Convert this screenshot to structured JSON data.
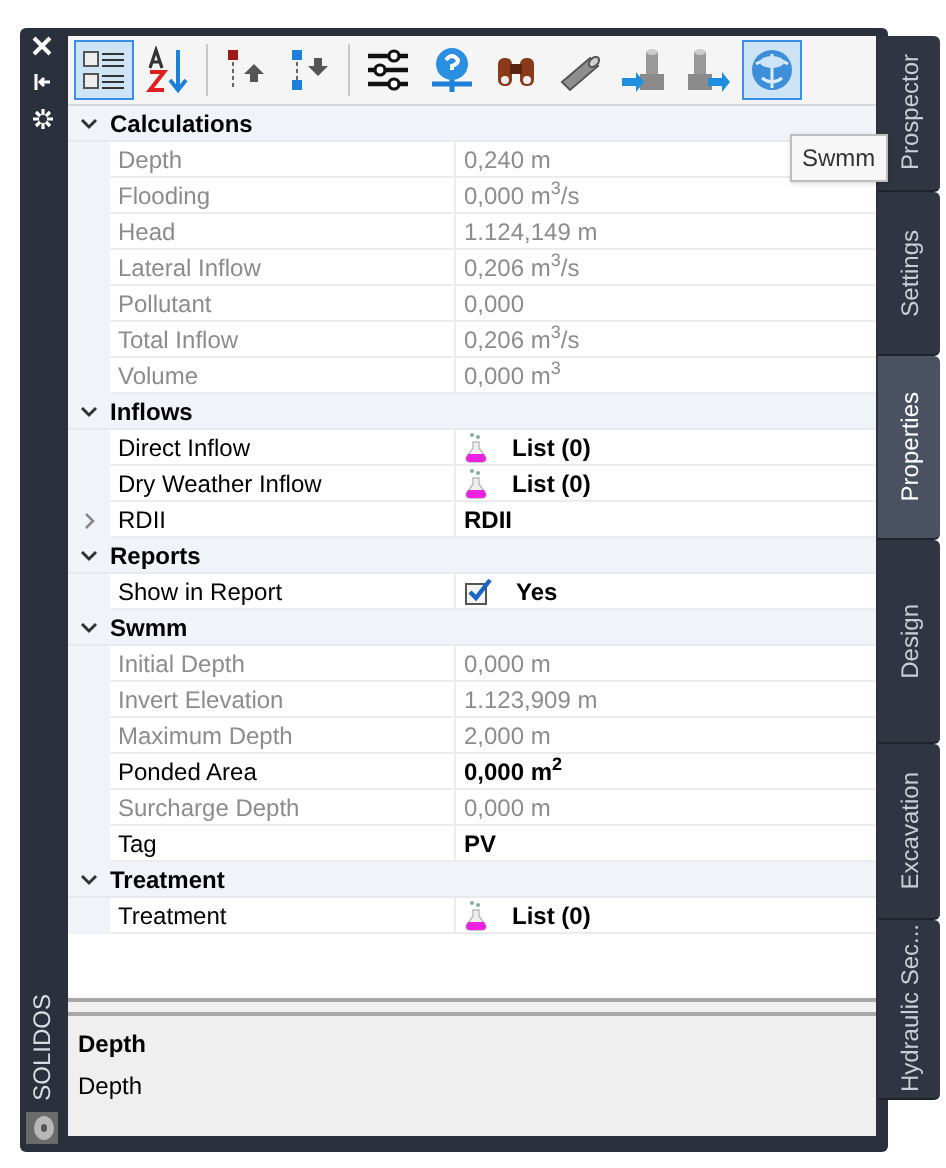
{
  "left_strip": {
    "title": "SOLIDOS"
  },
  "toolbar": [
    [
      {
        "kind": "categorized",
        "selected": true
      },
      {
        "kind": "alphabetical",
        "selected": false
      }
    ],
    [
      {
        "kind": "move-up",
        "selected": false
      },
      {
        "kind": "move-down",
        "selected": false
      }
    ],
    [
      {
        "kind": "filter",
        "selected": false
      },
      {
        "kind": "help",
        "selected": false
      },
      {
        "kind": "binoculars",
        "selected": false
      },
      {
        "kind": "pipe",
        "selected": false
      },
      {
        "kind": "inlet",
        "selected": false
      },
      {
        "kind": "outlet",
        "selected": false
      },
      {
        "kind": "swmm",
        "selected": true
      }
    ]
  ],
  "tooltip": "Swmm",
  "sections": [
    {
      "title": "Calculations",
      "expanded": true,
      "rows": [
        {
          "label": "Depth",
          "value": "0,240 m",
          "kind": "text",
          "disabled": true,
          "bold": false
        },
        {
          "label": "Flooding",
          "value": "0,000 m$^{3}$/s",
          "kind": "text",
          "disabled": true,
          "bold": false
        },
        {
          "label": "Head",
          "value": "1.124,149 m",
          "kind": "text",
          "disabled": true,
          "bold": false
        },
        {
          "label": "Lateral Inflow",
          "value": "0,206 m$^{3}$/s",
          "kind": "text",
          "disabled": true,
          "bold": false
        },
        {
          "label": "Pollutant",
          "value": "0,000",
          "kind": "text",
          "disabled": true,
          "bold": false
        },
        {
          "label": "Total Inflow",
          "value": "0,206 m$^{3}$/s",
          "kind": "text",
          "disabled": true,
          "bold": false
        },
        {
          "label": "Volume",
          "value": "0,000 m$^{3}$",
          "kind": "text",
          "disabled": true,
          "bold": false
        }
      ]
    },
    {
      "title": "Inflows",
      "expanded": true,
      "rows": [
        {
          "label": "Direct Inflow",
          "value": "List (0)",
          "kind": "list",
          "disabled": false,
          "bold": true
        },
        {
          "label": "Dry Weather Inflow",
          "value": "List (0)",
          "kind": "list",
          "disabled": false,
          "bold": true
        },
        {
          "label": "RDII",
          "value": "RDII",
          "kind": "group",
          "expanded": false,
          "disabled": false,
          "bold": true
        }
      ]
    },
    {
      "title": "Reports",
      "expanded": true,
      "rows": [
        {
          "label": "Show in Report",
          "value": "Yes",
          "kind": "check",
          "checked": true,
          "disabled": false,
          "bold": true
        }
      ]
    },
    {
      "title": "Swmm",
      "expanded": true,
      "rows": [
        {
          "label": "Initial Depth",
          "value": "0,000 m",
          "kind": "text",
          "disabled": true,
          "bold": false
        },
        {
          "label": "Invert Elevation",
          "value": "1.123,909 m",
          "kind": "text",
          "disabled": true,
          "bold": false
        },
        {
          "label": "Maximum Depth",
          "value": "2,000 m",
          "kind": "text",
          "disabled": true,
          "bold": false
        },
        {
          "label": "Ponded Area",
          "value": "0,000 m$^{2}$",
          "kind": "text",
          "disabled": false,
          "bold": true
        },
        {
          "label": "Surcharge Depth",
          "value": "0,000 m",
          "kind": "text",
          "disabled": true,
          "bold": false
        },
        {
          "label": "Tag",
          "value": "PV",
          "kind": "text",
          "disabled": false,
          "bold": true
        }
      ]
    },
    {
      "title": "Treatment",
      "expanded": true,
      "rows": [
        {
          "label": "Treatment",
          "value": "List (0)",
          "kind": "list",
          "disabled": false,
          "bold": true
        }
      ]
    }
  ],
  "description": {
    "title": "Depth",
    "text": "Depth"
  },
  "tabs": [
    {
      "label": "Prospector",
      "selected": false
    },
    {
      "label": "Settings",
      "selected": false
    },
    {
      "label": "Properties",
      "selected": true
    },
    {
      "label": "Design",
      "selected": false
    },
    {
      "label": "Excavation",
      "selected": false
    },
    {
      "label": "Hydraulic Sec...",
      "selected": false
    }
  ]
}
